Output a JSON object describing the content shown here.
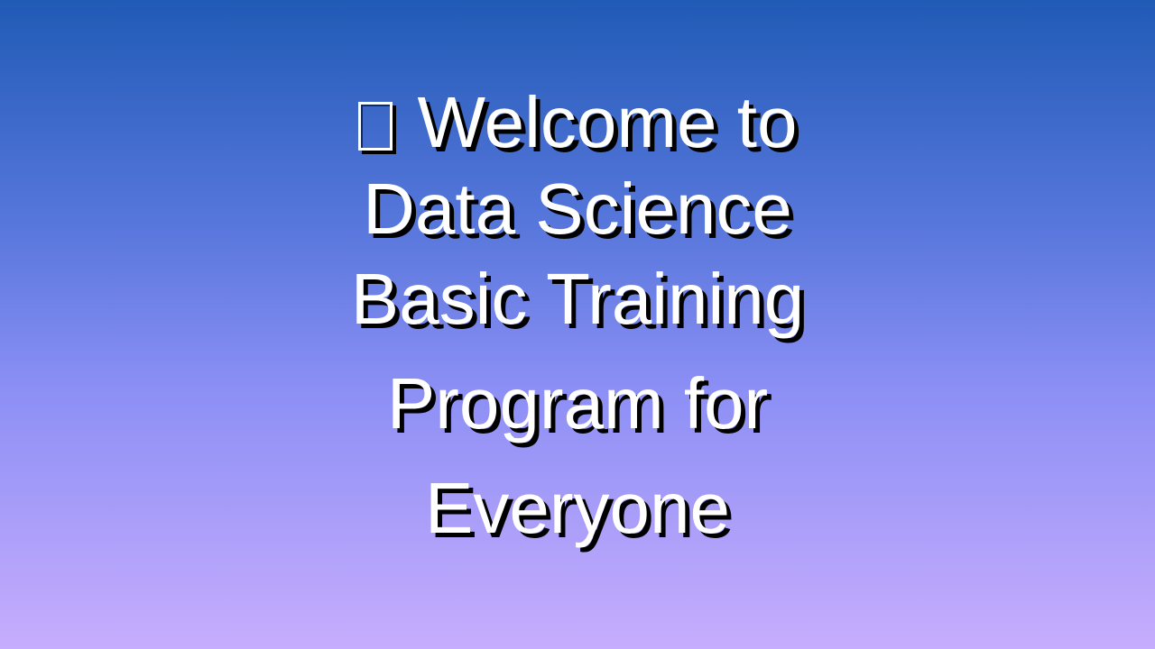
{
  "slide": {
    "icon": "missing-glyph-icon",
    "line1": "Welcome to",
    "line2": "Data Science",
    "line3": "Basic Training",
    "line4": "Program for",
    "line5": "Everyone"
  },
  "colors": {
    "text": "#ffffff",
    "shadow": "#000000",
    "gradient_top": "#205bb6",
    "gradient_bottom": "#c7adfd"
  }
}
